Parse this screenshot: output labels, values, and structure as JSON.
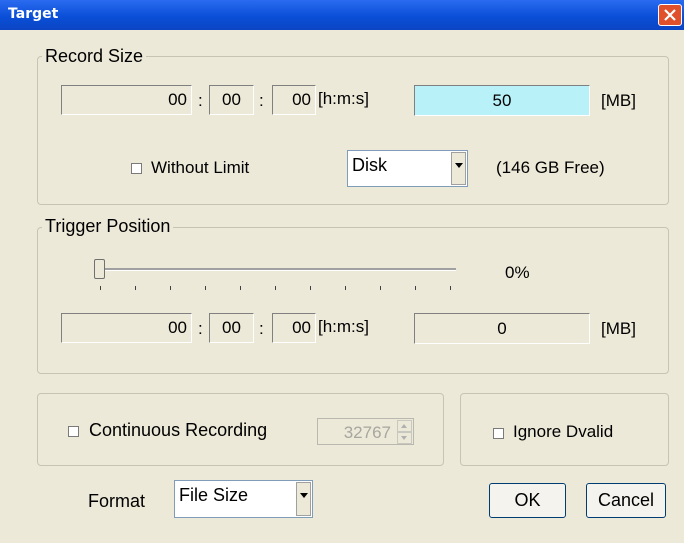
{
  "window": {
    "title": "Target"
  },
  "record_size": {
    "legend": "Record Size",
    "hours": "00",
    "minutes": "00",
    "seconds": "00",
    "time_unit": "[h:m:s]",
    "size_value": "50",
    "size_unit": "[MB]",
    "without_limit_label": "Without Limit",
    "destination": "Disk",
    "free_space": "(146 GB Free)"
  },
  "trigger_position": {
    "legend": "Trigger Position",
    "percent": "0%",
    "slider_value": 0,
    "hours": "00",
    "minutes": "00",
    "seconds": "00",
    "time_unit": "[h:m:s]",
    "size_value": "0",
    "size_unit": "[MB]"
  },
  "continuous": {
    "label": "Continuous Recording",
    "value": "32767"
  },
  "ignore_dvalid": {
    "label": "Ignore Dvalid"
  },
  "format": {
    "label": "Format",
    "value": "File Size"
  },
  "buttons": {
    "ok": "OK",
    "cancel": "Cancel"
  },
  "colors": {
    "title_bar": "#0a4fd8",
    "highlight_field": "#b8f1f8",
    "dialog_bg": "#ece9d8"
  }
}
